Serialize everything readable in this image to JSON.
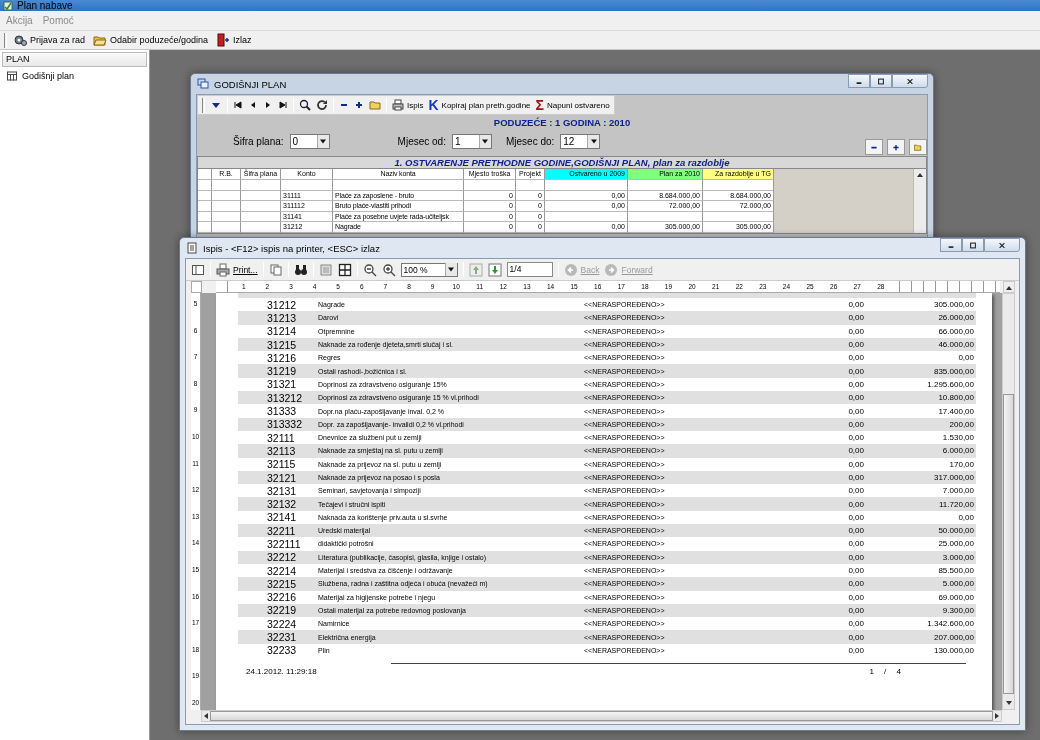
{
  "app": {
    "title": "Plan nabave",
    "menu": [
      "Akcija",
      "Pomoć"
    ],
    "toolbar": [
      "Prijava za rad",
      "Odabir poduzeće/godina",
      "Izlaz"
    ]
  },
  "sidebar": {
    "header": "PLAN",
    "items": [
      "Godišnji plan"
    ]
  },
  "plan_window": {
    "title": "GODIŠNJI PLAN",
    "actions": [
      {
        "kind": "printer",
        "label": "Ispis"
      },
      {
        "kind": "glyph",
        "icon": "K",
        "color": "#1038d0",
        "label": "Kopiraj plan preth.godine"
      },
      {
        "kind": "glyph",
        "icon": "Σ",
        "color": "#a01018",
        "label": "Napuni ostvareno"
      }
    ],
    "company_line": "PODUZEĆE : 1 GODINA : 2010",
    "filters": [
      {
        "label": "Šifra plana:",
        "value": "0"
      },
      {
        "label": "Mjesec od:",
        "value": "1"
      },
      {
        "label": "Mjesec do:",
        "value": "12"
      }
    ],
    "grid": {
      "title": "1.  OSTVARENJE PRETHODNE GODINE,GODIŠNJI PLAN, plan za razdoblje",
      "columns": [
        {
          "label": "R.B."
        },
        {
          "label": "Šifra plana"
        },
        {
          "label": "Konto"
        },
        {
          "label": "Naziv konta"
        },
        {
          "label": "Mjesto troška"
        },
        {
          "label": "Projekt"
        },
        {
          "label": "Ostvareno u 2009",
          "color": "#00ffff"
        },
        {
          "label": "Plan za 2010",
          "color": "#80ff80"
        },
        {
          "label": "Za razdoblje u TG",
          "color": "#ffff80"
        }
      ],
      "rows": [
        {
          "konto": "31111",
          "naziv": "Plaće za zaposlene - bruto",
          "mjesto": "0",
          "projekt": "0",
          "ostvareno": "0,00",
          "plan": "8.684.000,00",
          "razdoblje": "8.684.000,00"
        },
        {
          "konto": "311112",
          "naziv": "Bruto plaće-vlastiti prihodi",
          "mjesto": "0",
          "projekt": "0",
          "ostvareno": "0,00",
          "plan": "72.000,00",
          "razdoblje": "72.000,00"
        },
        {
          "konto": "31141",
          "naziv": "Plaće za posebne uvjete rada-učiteljsk",
          "mjesto": "0",
          "projekt": "0"
        },
        {
          "konto": "31212",
          "naziv": "Nagrade",
          "mjesto": "0",
          "projekt": "0",
          "ostvareno": "0,00",
          "plan": "305.000,00",
          "razdoblje": "305.000,00"
        }
      ]
    }
  },
  "print_window": {
    "title": "Ispis - <F12> ispis na printer, <ESC> izlaz",
    "print_label": "Print...",
    "zoom": "100 %",
    "page_field": "1/4",
    "nav": [
      {
        "label": "Back",
        "disabled": true
      },
      {
        "label": "Forward",
        "disabled": true
      }
    ],
    "ruler_marks": [
      "1",
      "2",
      "3",
      "4",
      "5",
      "6",
      "7",
      "8",
      "9",
      "10",
      "11",
      "12",
      "13",
      "14",
      "15",
      "16",
      "17",
      "18",
      "19",
      "20",
      "21",
      "22",
      "23",
      "24",
      "25",
      "26",
      "27",
      "28"
    ],
    "vruler_marks": [
      "5",
      "6",
      "7",
      "8",
      "9",
      "10",
      "11",
      "12",
      "13",
      "14",
      "15",
      "16",
      "17",
      "18",
      "19",
      "20"
    ],
    "report_rows": [
      {
        "konto": "31212",
        "naziv": "Nagrade",
        "raspored": "<<NERASPOREĐENO>>",
        "ostvareno": "0,00",
        "iznos": "305.000,00"
      },
      {
        "konto": "31213",
        "naziv": "Darovi",
        "raspored": "<<NERASPOREĐENO>>",
        "ostvareno": "0,00",
        "iznos": "26.000,00"
      },
      {
        "konto": "31214",
        "naziv": "Otpremnine",
        "raspored": "<<NERASPOREĐENO>>",
        "ostvareno": "0,00",
        "iznos": "66.000,00"
      },
      {
        "konto": "31215",
        "naziv": "Naknade za rođenje djeteta,smrti slučaj i sl.",
        "raspored": "<<NERASPOREĐENO>>",
        "ostvareno": "0,00",
        "iznos": "46.000,00"
      },
      {
        "konto": "31216",
        "naziv": "Regres",
        "raspored": "<<NERASPOREĐENO>>",
        "ostvareno": "0,00",
        "iznos": "0,00"
      },
      {
        "konto": "31219",
        "naziv": "Ostali rashodi-,božićnica i sl.",
        "raspored": "<<NERASPOREĐENO>>",
        "ostvareno": "0,00",
        "iznos": "835.000,00"
      },
      {
        "konto": "31321",
        "naziv": "Doprinosi za zdravstveno osiguranje 15%",
        "raspored": "<<NERASPOREĐENO>>",
        "ostvareno": "0,00",
        "iznos": "1.295.600,00"
      },
      {
        "konto": "313212",
        "naziv": "Doprinosi za zdravstveno osiguranje 15 % vl.prihodi",
        "raspored": "<<NERASPOREĐENO>>",
        "ostvareno": "0,00",
        "iznos": "10.800,00"
      },
      {
        "konto": "31333",
        "naziv": "Dopr.na plaću-zapošljavanje inval. 0,2 %",
        "raspored": "<<NERASPOREĐENO>>",
        "ostvareno": "0,00",
        "iznos": "17.400,00"
      },
      {
        "konto": "313332",
        "naziv": "Dopr. za zapošljavanje- invalidi 0,2 % vl.prihodi",
        "raspored": "<<NERASPOREĐENO>>",
        "ostvareno": "0,00",
        "iznos": "200,00"
      },
      {
        "konto": "32111",
        "naziv": "Dnevnice za službeni put u zemlji",
        "raspored": "<<NERASPOREĐENO>>",
        "ostvareno": "0,00",
        "iznos": "1.530,00"
      },
      {
        "konto": "32113",
        "naziv": "Naknade za smještaj na sl. putu u zemlji",
        "raspored": "<<NERASPOREĐENO>>",
        "ostvareno": "0,00",
        "iznos": "6.000,00"
      },
      {
        "konto": "32115",
        "naziv": "Naknade za prijevoz na sl. putu u zemlji",
        "raspored": "<<NERASPOREĐENO>>",
        "ostvareno": "0,00",
        "iznos": "170,00"
      },
      {
        "konto": "32121",
        "naziv": "Naknade za prijevoz na posao i s posla",
        "raspored": "<<NERASPOREĐENO>>",
        "ostvareno": "0,00",
        "iznos": "317.000,00"
      },
      {
        "konto": "32131",
        "naziv": "Seminari, savjetovanja i simpoziji",
        "raspored": "<<NERASPOREĐENO>>",
        "ostvareno": "0,00",
        "iznos": "7.000,00"
      },
      {
        "konto": "32132",
        "naziv": "Tečajevi i stručni ispiti",
        "raspored": "<<NERASPOREĐENO>>",
        "ostvareno": "0,00",
        "iznos": "11.720,00"
      },
      {
        "konto": "32141",
        "naziv": "Naknada za korištenje priv.auta u sl.svrhe",
        "raspored": "<<NERASPOREĐENO>>",
        "ostvareno": "0,00",
        "iznos": "0,00"
      },
      {
        "konto": "32211",
        "naziv": "Uredski materijal",
        "raspored": "<<NERASPOREĐENO>>",
        "ostvareno": "0,00",
        "iznos": "50.000,00"
      },
      {
        "konto": "322111",
        "naziv": "didaktički potrošni",
        "raspored": "<<NERASPOREĐENO>>",
        "ostvareno": "0,00",
        "iznos": "25.000,00"
      },
      {
        "konto": "32212",
        "naziv": "Literatura (publikacije, časopisi, glasila, knjige i ostalo)",
        "raspored": "<<NERASPOREĐENO>>",
        "ostvareno": "0,00",
        "iznos": "3.000,00"
      },
      {
        "konto": "32214",
        "naziv": "Materijal i sredstva za čišćenje i održavanje",
        "raspored": "<<NERASPOREĐENO>>",
        "ostvareno": "0,00",
        "iznos": "85.500,00"
      },
      {
        "konto": "32215",
        "naziv": "Službena, radna i zaštitna odjeća i obuća (nevažeći m)",
        "raspored": "<<NERASPOREĐENO>>",
        "ostvareno": "0,00",
        "iznos": "5.000,00"
      },
      {
        "konto": "32216",
        "naziv": "Materijal za higijenske potrebe i njegu",
        "raspored": "<<NERASPOREĐENO>>",
        "ostvareno": "0,00",
        "iznos": "69.000,00"
      },
      {
        "konto": "32219",
        "naziv": "Ostali materijal za potrebe redovnog poslovanja",
        "raspored": "<<NERASPOREĐENO>>",
        "ostvareno": "0,00",
        "iznos": "9.300,00"
      },
      {
        "konto": "32224",
        "naziv": "Namirnice",
        "raspored": "<<NERASPOREĐENO>>",
        "ostvareno": "0,00",
        "iznos": "1.342.600,00"
      },
      {
        "konto": "32231",
        "naziv": "Električna energija",
        "raspored": "<<NERASPOREĐENO>>",
        "ostvareno": "0,00",
        "iznos": "207.000,00"
      },
      {
        "konto": "32233",
        "naziv": "Plin",
        "raspored": "<<NERASPOREĐENO>>",
        "ostvareno": "0,00",
        "iznos": "130.000,00"
      }
    ],
    "footer": {
      "timestamp": "24.1.2012. 11:29:18",
      "page": "1 / 4"
    }
  }
}
